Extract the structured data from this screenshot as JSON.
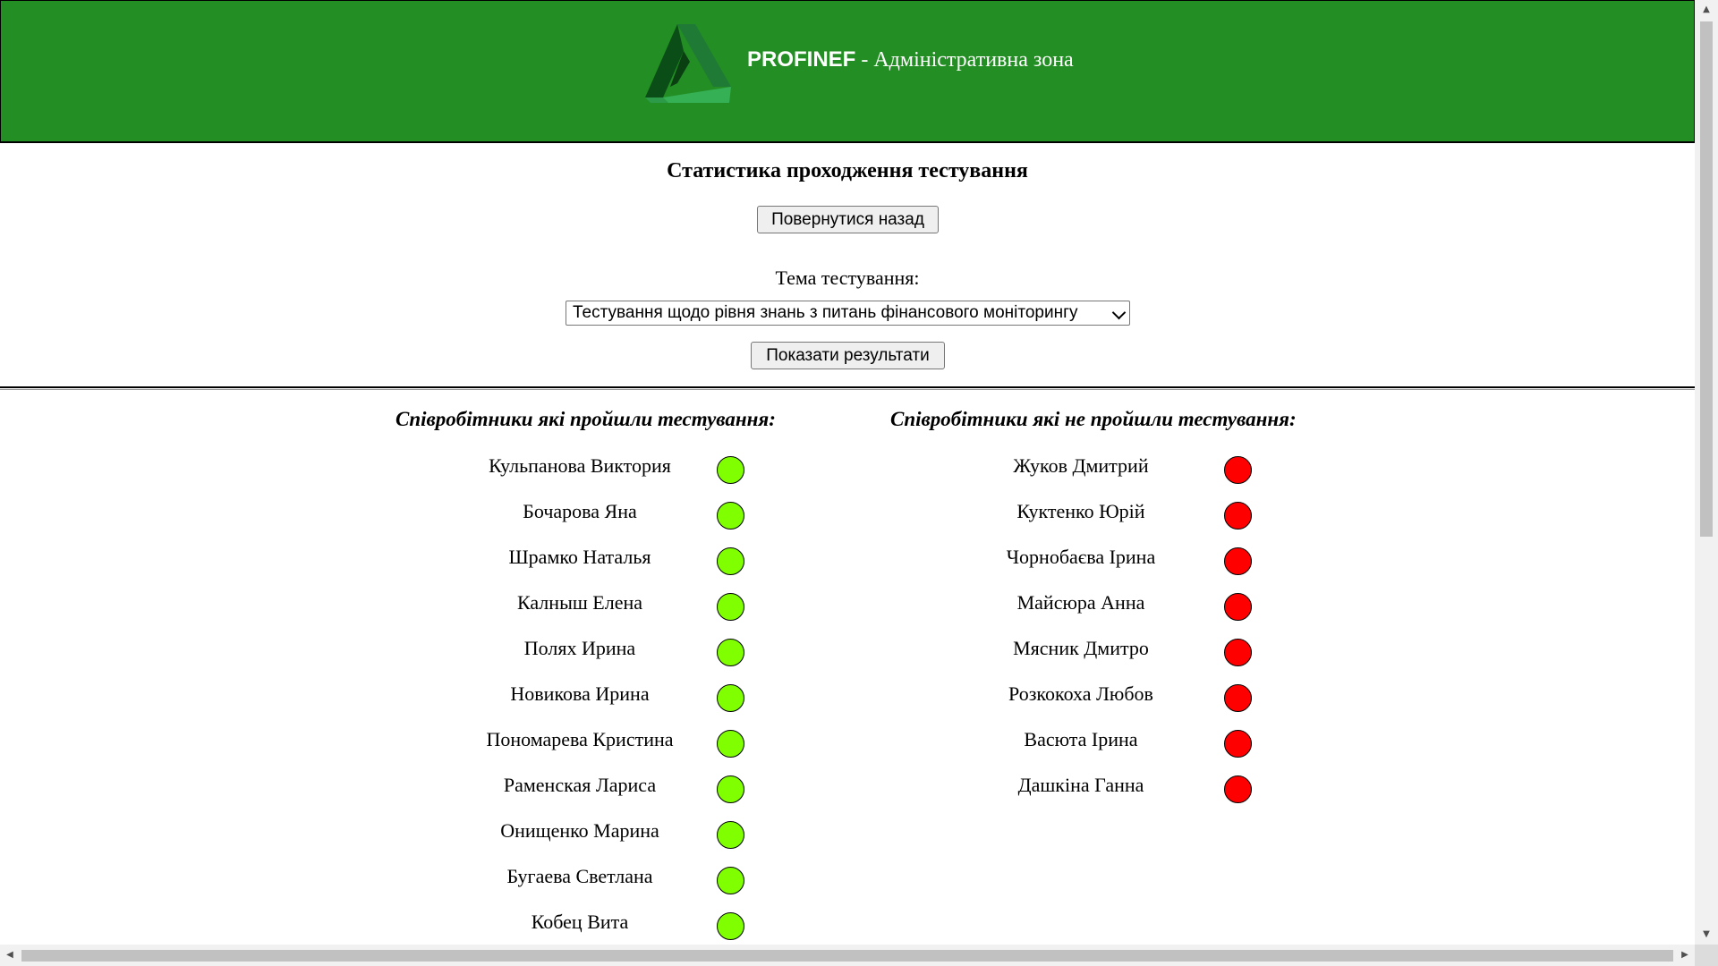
{
  "header": {
    "brand": "PROFINEF",
    "subtitle": " - Адміністративна зона",
    "bg_color": "#238E23",
    "logo_icon": "triangle-logo-icon"
  },
  "page": {
    "title": "Статистика проходження тестування",
    "back_button": "Повернутися назад",
    "topic_label": "Тема тестування:",
    "topic_selected": "Тестування щодо рівня знань з питань фінансового моніторингу",
    "show_button": "Показати результати"
  },
  "passed": {
    "title": "Співробітники які пройшли тестування:",
    "status_color": "#7FFF00",
    "employees": [
      "Кульпанова Виктория",
      "Бочарова Яна",
      "Шрамко Наталья",
      "Калныш Елена",
      "Полях Ирина",
      "Новикова Ирина",
      "Пономарева Кристина",
      "Раменская Лариса",
      "Онищенко Марина",
      "Бугаева Светлана",
      "Кобец Вита"
    ]
  },
  "failed": {
    "title": "Співробітники які не пройшли тестування:",
    "status_color": "#FF0000",
    "employees": [
      "Жуков Дмитрий",
      "Куктенко Юрій",
      "Чорнобаєва Ірина",
      "Майсюра Анна",
      "Мясник Дмитро",
      "Розкокоха Любов",
      "Васюта Ірина",
      "Дашкіна Ганна"
    ]
  }
}
